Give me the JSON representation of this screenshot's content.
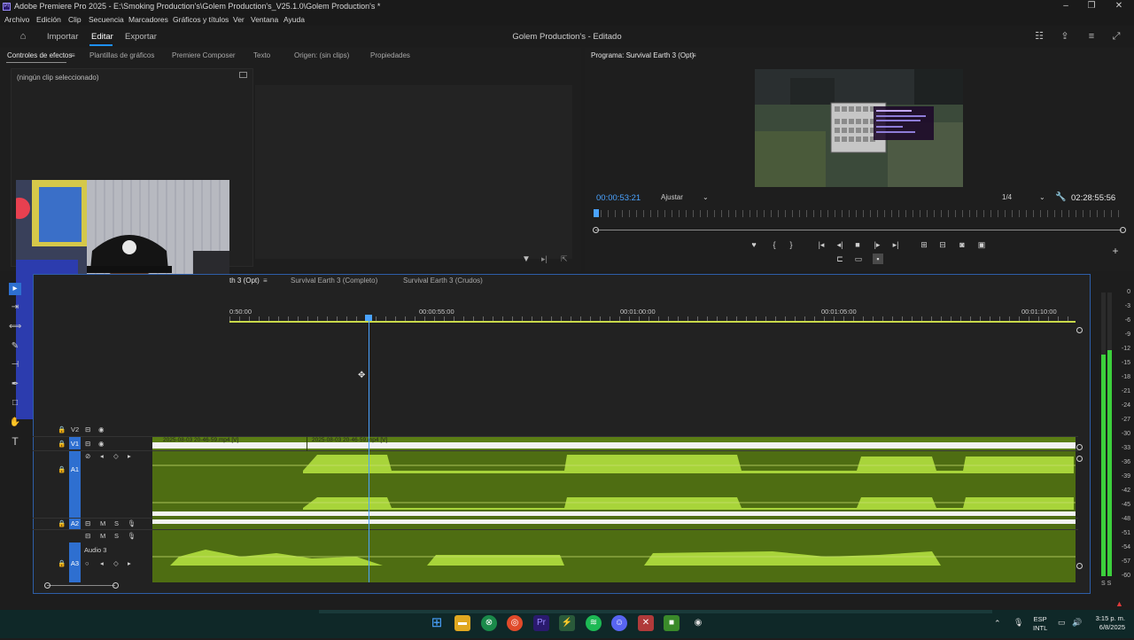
{
  "window": {
    "title": "Adobe Premiere Pro 2025 - E:\\Smoking Production's\\Golem Production's_V25.1.0\\Golem Production's *",
    "app_icon": "Pr",
    "controls": [
      "minimize-icon",
      "maximize-icon",
      "close-icon"
    ]
  },
  "menu": [
    "Archivo",
    "Edición",
    "Clip",
    "Secuencia",
    "Marcadores",
    "Gráficos y títulos",
    "Ver",
    "Ventana",
    "Ayuda"
  ],
  "header": {
    "nav": [
      "Importar",
      "Editar",
      "Exportar"
    ],
    "active": "Editar",
    "project_title": "Golem Production's - Editado"
  },
  "effects_panel": {
    "tabs": [
      "Controles de efectos",
      "Plantillas de gráficos",
      "Premiere Composer",
      "Texto",
      "Origen: (sin clips)",
      "Propiedades"
    ],
    "empty_text": "(ningún clip seleccionado)"
  },
  "program_monitor": {
    "label": "Programa: Survival Earth 3 (Opt)",
    "timecode": "00:00:53:21",
    "fit": "Ajustar",
    "resolution": "1/4",
    "duration": "02:28:55:56",
    "playhead_fraction": 0.005
  },
  "timeline": {
    "tabs": [
      "th 3 (Opt)",
      "Survival Earth 3 (Completo)",
      "Survival Earth 3 (Crudos)"
    ],
    "ruler": [
      "0:50:00",
      "00:00:55:00",
      "00:01:00:00",
      "00:01:05:00",
      "00:01:10:00"
    ],
    "tracks": [
      {
        "id": "V2",
        "label": "V2"
      },
      {
        "id": "V1",
        "label": "V1"
      },
      {
        "id": "A1",
        "label": "A1"
      },
      {
        "id": "A2",
        "label": "A2"
      },
      {
        "id": "A3",
        "label": "A3",
        "name": "Audio 3"
      }
    ],
    "clips": [
      "2025-08-03 20-46-59.mp4 [V]",
      "2025-08-03 20-46-59.mp4 [V]"
    ]
  },
  "meter": {
    "labels": [
      "0",
      "-3",
      "-6",
      "-9",
      "-12",
      "-15",
      "-18",
      "-21",
      "-24",
      "-27",
      "-30",
      "-33",
      "-36",
      "-39",
      "-42",
      "-45",
      "-48",
      "-51",
      "-54",
      "-57",
      "-60"
    ],
    "bottom": "S S"
  },
  "taskbar": {
    "lang": "ESP",
    "layout": "INTL",
    "time": "3:15 p. m.",
    "date": "6/8/2025"
  },
  "colors": {
    "accent": "#1e90ff",
    "audio_wave": "#a8d43a",
    "audio_bg": "#4e6d12",
    "track_target": "#2e6fd0",
    "meter_green": "#3ccf3c"
  }
}
